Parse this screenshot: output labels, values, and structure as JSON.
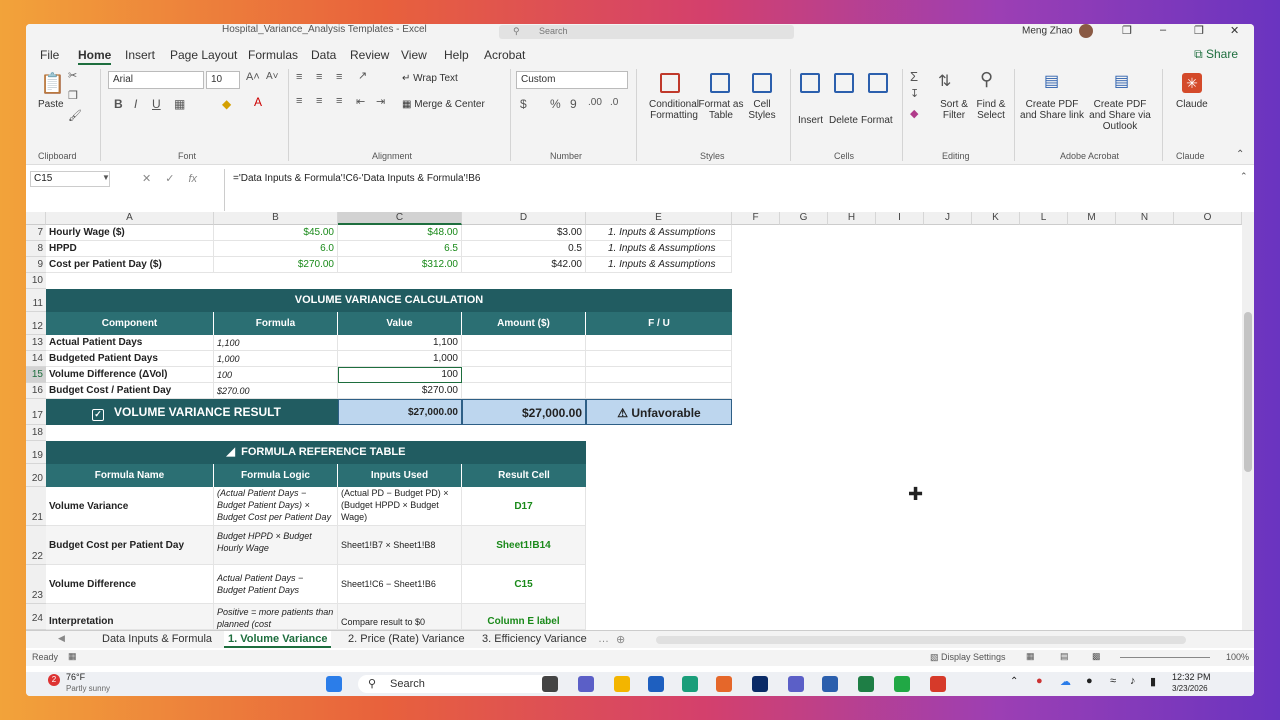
{
  "window": {
    "title": "Hospital_Variance_Analysis Templates - Excel",
    "search": "Search",
    "user": "Meng Zhao",
    "controls": [
      "❐",
      "–",
      "❐",
      "✕"
    ]
  },
  "menu": {
    "items": [
      "File",
      "Home",
      "Insert",
      "Page Layout",
      "Formulas",
      "Data",
      "Review",
      "View",
      "Help",
      "Acrobat"
    ],
    "share": "Share"
  },
  "ribbon": {
    "paste": "Paste",
    "font_name": "Arial",
    "font_size": "10",
    "wrap": "Wrap Text",
    "merge": "Merge & Center",
    "number_format": "Custom",
    "cond": "Conditional Formatting",
    "fmt_table": "Format as Table",
    "cell_styles": "Cell Styles",
    "insert": "Insert",
    "delete": "Delete",
    "format": "Format",
    "sort": "Sort & Filter",
    "find": "Find & Select",
    "pdf1": "Create PDF and Share link",
    "pdf2": "Create PDF and Share via Outlook",
    "claude": "Claude",
    "groups": [
      "Clipboard",
      "Font",
      "Alignment",
      "Number",
      "Styles",
      "Cells",
      "Editing",
      "Adobe Acrobat",
      "Claude"
    ]
  },
  "formula_bar": {
    "name_box": "C15",
    "formula": "='Data Inputs & Formula'!C6-'Data Inputs & Formula'!B6"
  },
  "columns": [
    "A",
    "B",
    "C",
    "D",
    "E",
    "F",
    "G",
    "H",
    "I",
    "J",
    "K",
    "L",
    "M",
    "N",
    "O"
  ],
  "rows": {
    "r7": {
      "a": "Hourly Wage ($)",
      "b": "$45.00",
      "c": "$48.00",
      "d": "$3.00",
      "e": "1. Inputs & Assumptions"
    },
    "r8": {
      "a": "HPPD",
      "b": "6.0",
      "c": "6.5",
      "d": "0.5",
      "e": "1. Inputs & Assumptions"
    },
    "r9": {
      "a": "Cost per Patient Day ($)",
      "b": "$270.00",
      "c": "$312.00",
      "d": "$42.00",
      "e": "1. Inputs & Assumptions"
    },
    "r11": {
      "title": "VOLUME VARIANCE CALCULATION"
    },
    "r12": {
      "a": "Component",
      "b": "Formula",
      "c": "Value",
      "d": "Amount ($)",
      "e": "F / U"
    },
    "r13": {
      "a": "Actual Patient Days",
      "b": "1,100",
      "c": "1,100"
    },
    "r14": {
      "a": "Budgeted Patient Days",
      "b": "1,000",
      "c": "1,000"
    },
    "r15": {
      "a": "Volume Difference (ΔVol)",
      "b": "100",
      "c": "100"
    },
    "r16": {
      "a": "Budget Cost / Patient Day",
      "b": "$270.00",
      "c": "$270.00"
    },
    "r17": {
      "a": "VOLUME VARIANCE RESULT",
      "c": "$27,000.00",
      "d": "$27,000.00",
      "e": "Unfavorable"
    },
    "r19": {
      "title": "FORMULA REFERENCE TABLE"
    },
    "r20": {
      "a": "Formula Name",
      "b": "Formula Logic",
      "c": "Inputs Used",
      "d": "Result Cell"
    },
    "r21": {
      "a": "Volume Variance",
      "b": "(Actual Patient Days − Budget Patient Days) × Budget Cost per Patient Day",
      "c": "(Actual PD − Budget PD) × (Budget HPPD × Budget Wage)",
      "d": "D17"
    },
    "r22": {
      "a": "Budget Cost per Patient Day",
      "b": "Budget HPPD × Budget Hourly Wage",
      "c": "Sheet1!B7 × Sheet1!B8",
      "d": "Sheet1!B14"
    },
    "r23": {
      "a": "Volume Difference",
      "b": "Actual Patient Days − Budget Patient Days",
      "c": "Sheet1!C6 − Sheet1!B6",
      "d": "C15"
    },
    "r24": {
      "a": "Interpretation",
      "b": "Positive = more patients than planned (cost",
      "c": "Compare result to $0",
      "d": "Column E label"
    }
  },
  "tabs": [
    "Data Inputs & Formula",
    "1. Volume Variance",
    "2. Price (Rate) Variance",
    "3. Efficiency Variance"
  ],
  "status": {
    "ready": "Ready",
    "display": "Display Settings",
    "zoom": "100%"
  },
  "taskbar": {
    "weather": "76°F",
    "weather_sub": "Partly sunny",
    "search": "Search",
    "time": "12:32 PM",
    "date": "3/23/2026"
  }
}
